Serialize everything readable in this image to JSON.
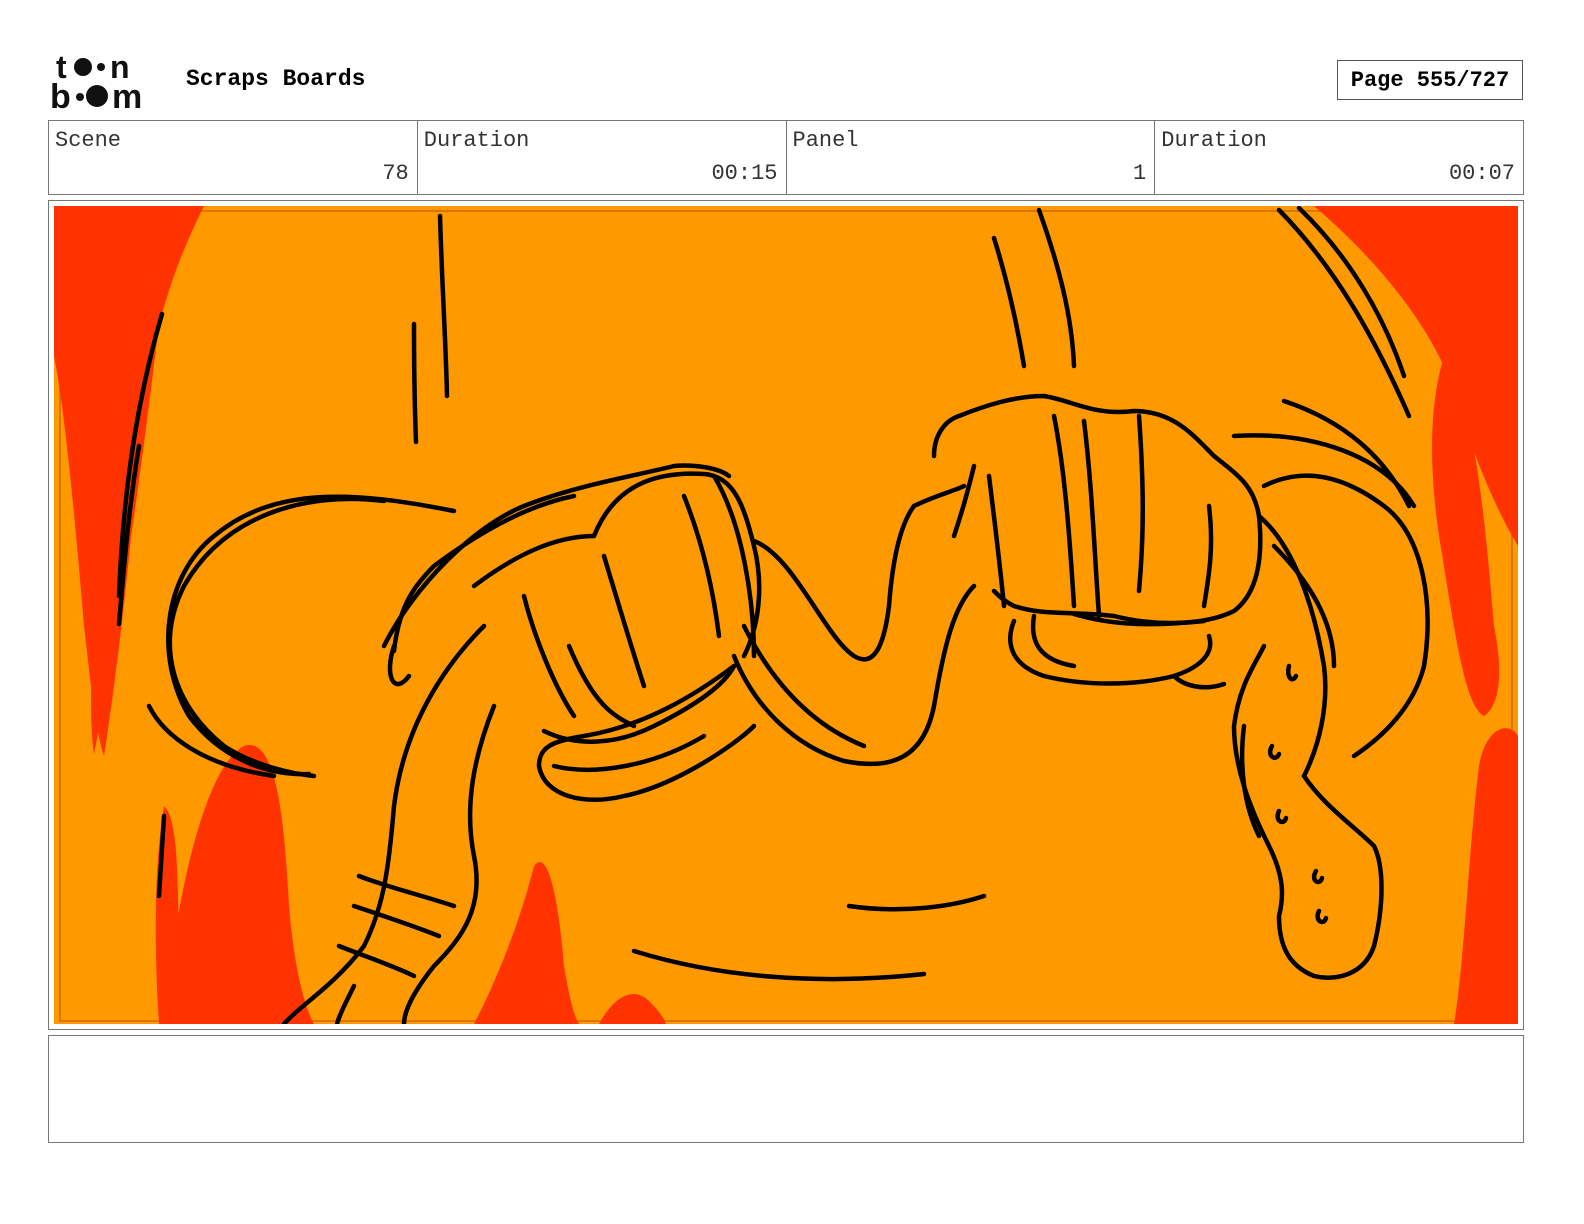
{
  "header": {
    "logo_top": "toon",
    "logo_bottom": "boom",
    "title": "Scraps Boards",
    "page": "Page 555/727"
  },
  "info": {
    "scene_label": "Scene",
    "scene_value": "78",
    "scene_duration_label": "Duration",
    "scene_duration_value": "00:15",
    "panel_label": "Panel",
    "panel_value": "1",
    "panel_duration_label": "Duration",
    "panel_duration_value": "00:07"
  },
  "panel": {
    "background_color": "#FF9900",
    "flame_color": "#FF3300",
    "line_color": "#000000"
  },
  "notes": {
    "text": ""
  }
}
